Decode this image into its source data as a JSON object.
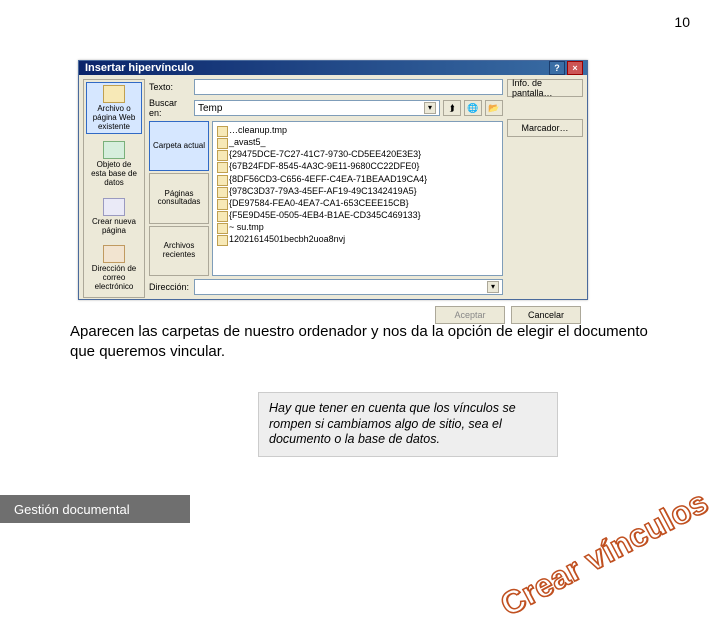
{
  "page_number": "10",
  "dialog": {
    "title": "Insertar hipervínculo",
    "text_label": "Texto:",
    "text_value": "",
    "lookin_label": "Buscar en:",
    "lookin_value": "Temp",
    "address_label": "Dirección:",
    "address_value": "",
    "screen_tip_btn": "Info. de pantalla…",
    "bookmark_btn": "Marcador…",
    "accept_btn": "Aceptar",
    "cancel_btn": "Cancelar",
    "link_to": [
      "Archivo o página Web existente",
      "Objeto de esta base de datos",
      "Crear nueva página",
      "Dirección de correo electrónico"
    ],
    "sub_tabs": [
      "Carpeta actual",
      "Páginas consultadas",
      "Archivos recientes"
    ],
    "icon_buttons": {
      "up": "up-one-level-icon",
      "browse_web": "browse-web-icon",
      "browse_file": "browse-file-icon"
    },
    "files": [
      "…cleanup.tmp",
      "_avast5_",
      "{29475DCE-7C27-41C7-9730-CD5EE420E3E3}",
      "{67B24FDF-8545-4A3C-9E11-9680CC22DFE0}",
      "{8DF56CD3-C656-4EFF-C4EA-71BEAAD19CA4}",
      "{978C3D37-79A3-45EF-AF19-49C1342419A5}",
      "{DE97584-FEA0-4EA7-CA1-653CEEE15CB}",
      "{F5E9D45E-0505-4EB4-B1AE-CD345C469133}",
      "~ su.tmp",
      "12021614501becbh2uoa8nvj"
    ]
  },
  "main_text": "Aparecen las carpetas de nuestro ordenador y nos da la opción de elegir el documento que queremos vincular.",
  "note_text": "Hay que tener en cuenta que los vínculos se rompen si cambiamos algo de sitio, sea el documento o la base de datos.",
  "footer_label": "Gestión documental",
  "wordart": "Crear vínculos"
}
